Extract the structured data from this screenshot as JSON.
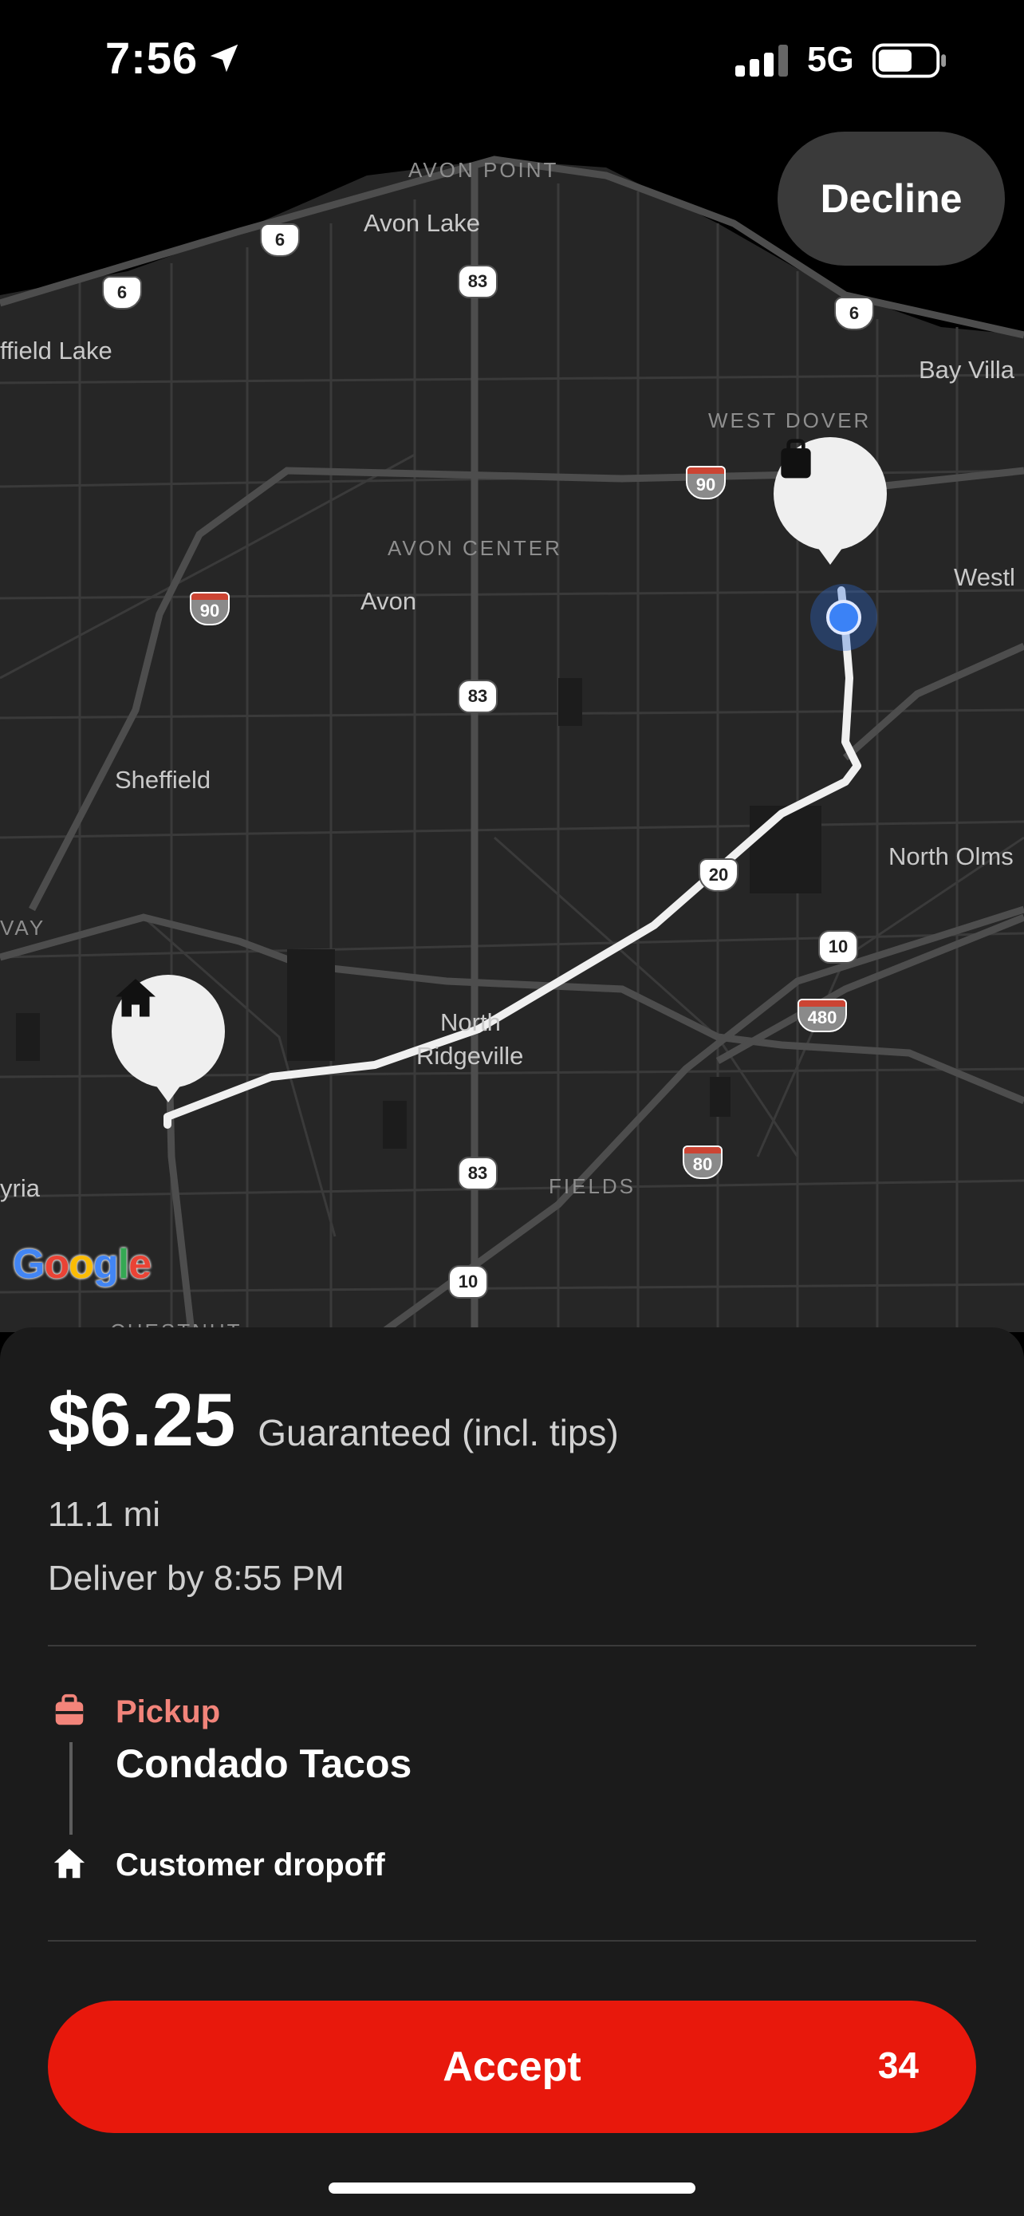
{
  "status_bar": {
    "time": "7:56",
    "network": "5G",
    "battery_level": 0.6
  },
  "map": {
    "labels": {
      "avon_point": "AVON POINT",
      "avon_lake": "Avon Lake",
      "sheffield_lake": "ffield Lake",
      "bay_village": "Bay Villa",
      "west_dover": "WEST DOVER",
      "avon_center": "AVON CENTER",
      "avon": "Avon",
      "westlake": "Westl",
      "sheffield": "Sheffield",
      "north_olmsted": "North Olms",
      "vay": "VAY",
      "north_ridgeville_1": "North",
      "north_ridgeville_2": "Ridgeville",
      "elyria": "yria",
      "fields": "FIELDS",
      "chestnut": "CHESTNUT"
    },
    "shields": {
      "us6_a": "6",
      "us6_b": "6",
      "us6_c": "6",
      "sr83_a": "83",
      "sr83_b": "83",
      "sr83_c": "83",
      "i90_a": "90",
      "i90_b": "90",
      "us20": "20",
      "sr10_a": "10",
      "sr10_b": "10",
      "i480": "480",
      "i80": "80"
    },
    "attribution": "Google",
    "pickup_pin_icon": "bag-icon",
    "dropoff_pin_icon": "home-icon"
  },
  "decline_label": "Decline",
  "offer": {
    "amount": "$6.25",
    "amount_note": "Guaranteed (incl. tips)",
    "distance": "11.1 mi",
    "deliver_by": "Deliver by 8:55 PM",
    "pickup_label": "Pickup",
    "pickup_name": "Condado Tacos",
    "dropoff_label": "Customer dropoff",
    "accent_color": "#f2847a"
  },
  "accept": {
    "label": "Accept",
    "countdown": "34",
    "color": "#e8180c"
  }
}
